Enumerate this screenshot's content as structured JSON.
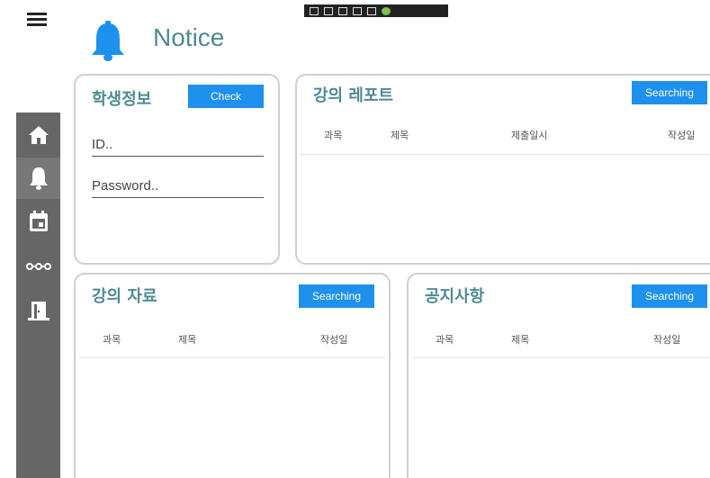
{
  "page": {
    "title": "Notice"
  },
  "student_info": {
    "title": "학생정보",
    "check_label": "Check",
    "id_placeholder": "ID..",
    "password_placeholder": "Password.."
  },
  "lecture_report": {
    "title": "강의 레포트",
    "search_label": "Searching",
    "columns": [
      "과목",
      "제목",
      "제출일시",
      "작성일"
    ]
  },
  "lecture_material": {
    "title": "강의 자료",
    "search_label": "Searching",
    "columns": [
      "과목",
      "제목",
      "작성일"
    ]
  },
  "announcements": {
    "title": "공지사항",
    "search_label": "Searching",
    "columns": [
      "과목",
      "제목",
      "작성일"
    ]
  },
  "sidebar": {
    "items": [
      {
        "icon": "home-icon"
      },
      {
        "icon": "bell-icon"
      },
      {
        "icon": "calendar-icon"
      },
      {
        "icon": "connection-icon"
      },
      {
        "icon": "exit-door-icon"
      }
    ]
  },
  "colors": {
    "accent": "#1e90ee",
    "title": "#4f8a95",
    "sidebar": "#666666",
    "border": "#cfcfcf"
  }
}
